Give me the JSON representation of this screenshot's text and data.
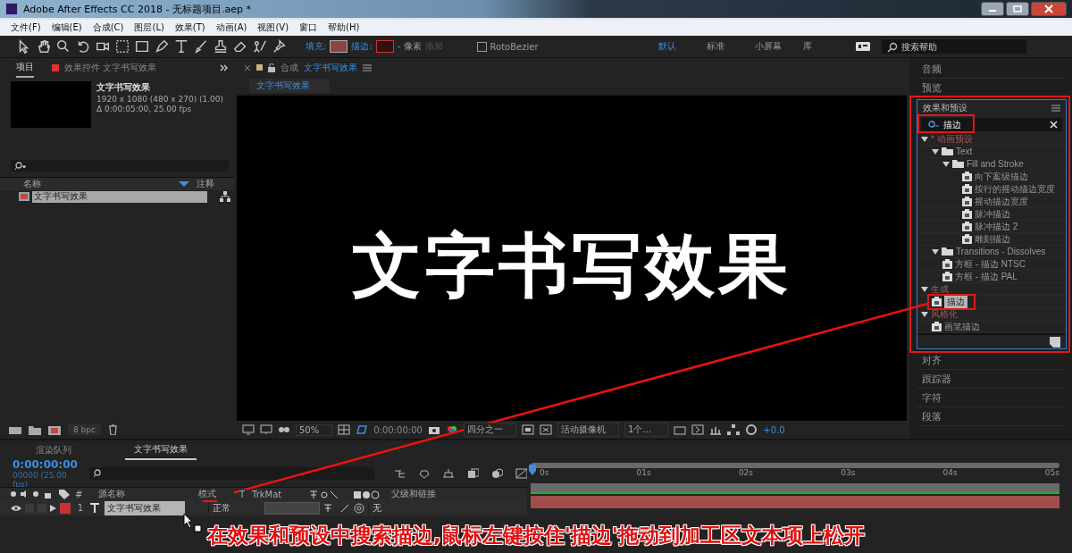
{
  "window": {
    "title": "Adobe After Effects CC 2018 - 无标题项目.aep *"
  },
  "menu": [
    "文件(F)",
    "编辑(E)",
    "合成(C)",
    "图层(L)",
    "效果(T)",
    "动画(A)",
    "视图(V)",
    "窗口",
    "帮助(H)"
  ],
  "toolbar": {
    "fill_label": "填充:",
    "stroke_label": "描边:",
    "stroke_width": "- 像素",
    "add": "添加",
    "rotobezier": {
      "label": "RotoBezier",
      "checked": false
    },
    "workspaces": [
      {
        "label": "默认",
        "selected": true
      },
      {
        "label": "标准",
        "selected": false
      },
      {
        "label": "小屏幕",
        "selected": false
      },
      {
        "label": "库",
        "selected": false
      }
    ],
    "search": {
      "placeholder": "搜索帮助"
    }
  },
  "project_panel": {
    "tabs": [
      {
        "label": "项目",
        "selected": true
      },
      {
        "label": "效果控件 文字书写效果",
        "selected": false
      }
    ],
    "comp_name": "文字书写效果",
    "size": "1920 x 1080  (480 x 270) (1.00)",
    "duration": "Δ 0:00:05:00, 25.00 fps",
    "columns": [
      "名称",
      "注释"
    ],
    "items": [
      {
        "name": "文字书写效果",
        "selected": true
      }
    ],
    "bpc": "8 bpc"
  },
  "composition": {
    "tab_prefix": "合成",
    "tab_name": "文字书写效果",
    "breadcrumb": "文字书写效果",
    "canvas_text": "文字书写效果",
    "zoom": "50%",
    "time": "0:00:00:00",
    "resolution": "四分之一",
    "camera": "活动摄像机",
    "views": "1个…",
    "exposure": "+0.0"
  },
  "right_panel": {
    "top": [
      "音频",
      "预览"
    ],
    "effects": {
      "title": "效果和预设",
      "search": "描边",
      "tree": [
        {
          "label": "* 动画预设",
          "kind": "category",
          "expanded": true,
          "children": [
            {
              "label": "Text",
              "kind": "folder",
              "expanded": true,
              "children": [
                {
                  "label": "Fill and Stroke",
                  "kind": "folder",
                  "expanded": true,
                  "children": [
                    {
                      "label": "向下案级描边",
                      "kind": "preset",
                      "selected": false
                    },
                    {
                      "label": "按行的摇动描边宽度",
                      "kind": "preset",
                      "selected": false
                    },
                    {
                      "label": "摇动描边宽度",
                      "kind": "preset",
                      "selected": false
                    },
                    {
                      "label": "脉冲描边",
                      "kind": "preset",
                      "selected": false
                    },
                    {
                      "label": "脉冲描边 2",
                      "kind": "preset",
                      "selected": false
                    },
                    {
                      "label": "雕刻描边",
                      "kind": "preset",
                      "selected": false
                    }
                  ]
                }
              ]
            },
            {
              "label": "Transitions - Dissolves",
              "kind": "folder",
              "expanded": true,
              "children": [
                {
                  "label": "方框 - 描边 NTSC",
                  "kind": "preset",
                  "selected": false
                },
                {
                  "label": "方框 - 描边 PAL",
                  "kind": "preset",
                  "selected": false
                }
              ]
            }
          ]
        },
        {
          "label": "生成",
          "kind": "category",
          "expanded": true,
          "children": [
            {
              "label": "描边",
              "kind": "effect",
              "selected": true
            }
          ]
        },
        {
          "label": "风格化",
          "kind": "category",
          "expanded": true,
          "children": [
            {
              "label": "画笔描边",
              "kind": "effect",
              "selected": false
            }
          ]
        }
      ]
    },
    "bottom": [
      "对齐",
      "跟踪器",
      "字符",
      "段落"
    ]
  },
  "timeline": {
    "tabs": [
      {
        "label": "渲染队列",
        "selected": false
      },
      {
        "label": "文字书写效果",
        "selected": true
      }
    ],
    "time": "0:00:00:00",
    "frame": "00000 (25.00 fps)",
    "columns": [
      "#",
      "源名称",
      "模式",
      "T",
      "TrkMat",
      "父级和链接"
    ],
    "layers": [
      {
        "number": "1",
        "name": "文字书写效果",
        "mode": "正常",
        "parent": "无",
        "selected": true,
        "color": "#c83232"
      }
    ],
    "ruler": [
      "0s",
      "01s",
      "02s",
      "03s",
      "04s",
      "05s"
    ]
  },
  "annotation": {
    "caption": "在效果和预设中搜索描边,鼠标左键按住'描边'拖动到加工区文本项上松开"
  }
}
